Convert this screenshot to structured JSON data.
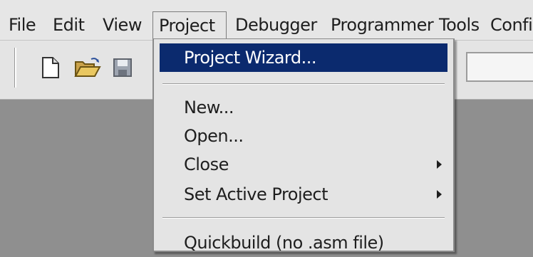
{
  "menubar": {
    "items": [
      {
        "label": "File"
      },
      {
        "label": "Edit"
      },
      {
        "label": "View"
      },
      {
        "label": "Project"
      },
      {
        "label": "Debugger"
      },
      {
        "label": "Programmer"
      },
      {
        "label": "Tools"
      },
      {
        "label": "Confi"
      }
    ]
  },
  "toolbar": {
    "icons": [
      "new-file-icon",
      "open-folder-icon",
      "save-icon"
    ]
  },
  "project_menu": {
    "items": [
      {
        "label": "Project Wizard..."
      },
      {
        "label": "New..."
      },
      {
        "label": "Open..."
      },
      {
        "label": "Close"
      },
      {
        "label": "Set Active Project"
      },
      {
        "label": "Quickbuild (no .asm file)"
      }
    ]
  },
  "colors": {
    "highlight": "#0b2a6e",
    "menu_bg": "#e4e4e4",
    "workspace": "#8f8f8f"
  }
}
